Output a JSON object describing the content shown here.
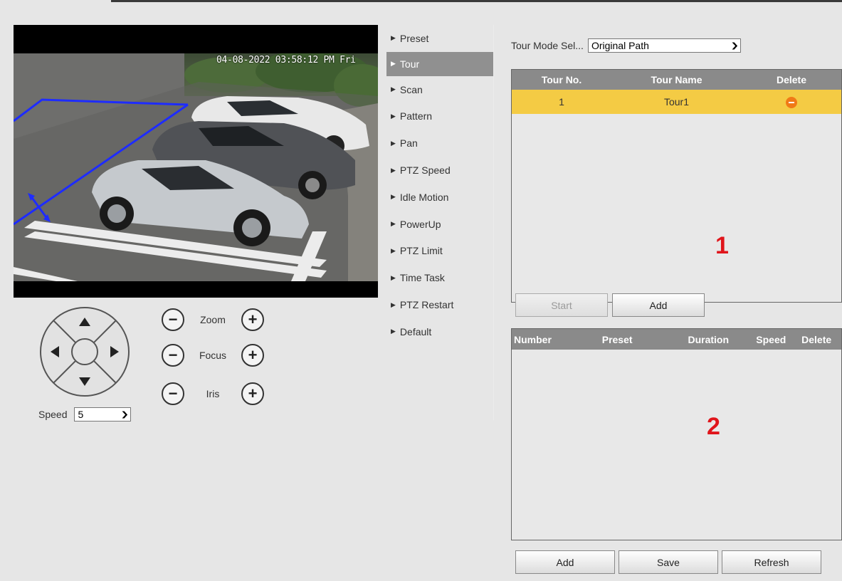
{
  "video": {
    "osd_text": "04-08-2022 03:58:12 PM Fri"
  },
  "ptz": {
    "speed_label": "Speed",
    "speed_value": "5",
    "zoom_label": "Zoom",
    "focus_label": "Focus",
    "iris_label": "Iris"
  },
  "menu": {
    "items": [
      "Preset",
      "Tour",
      "Scan",
      "Pattern",
      "Pan",
      "PTZ Speed",
      "Idle Motion",
      "PowerUp",
      "PTZ Limit",
      "Time Task",
      "PTZ Restart",
      "Default"
    ],
    "active": "Tour"
  },
  "tour_mode": {
    "label": "Tour Mode Sel...",
    "value": "Original Path"
  },
  "tour_table": {
    "headers": [
      "Tour No.",
      "Tour Name",
      "Delete"
    ],
    "rows": [
      {
        "no": "1",
        "name": "Tour1"
      }
    ],
    "callout": "1"
  },
  "tour_buttons": {
    "start": "Start",
    "add": "Add"
  },
  "preset_table": {
    "headers": [
      "Number",
      "Preset",
      "Duration",
      "Speed",
      "Delete"
    ],
    "callout": "2"
  },
  "bottom_buttons": {
    "add": "Add",
    "save": "Save",
    "refresh": "Refresh"
  },
  "colors": {
    "selected_row": "#f4cb44",
    "header_bg": "#8a8a8a",
    "menu_active": "#909090",
    "delete_icon": "#f07a17",
    "callout": "#e0151b"
  }
}
